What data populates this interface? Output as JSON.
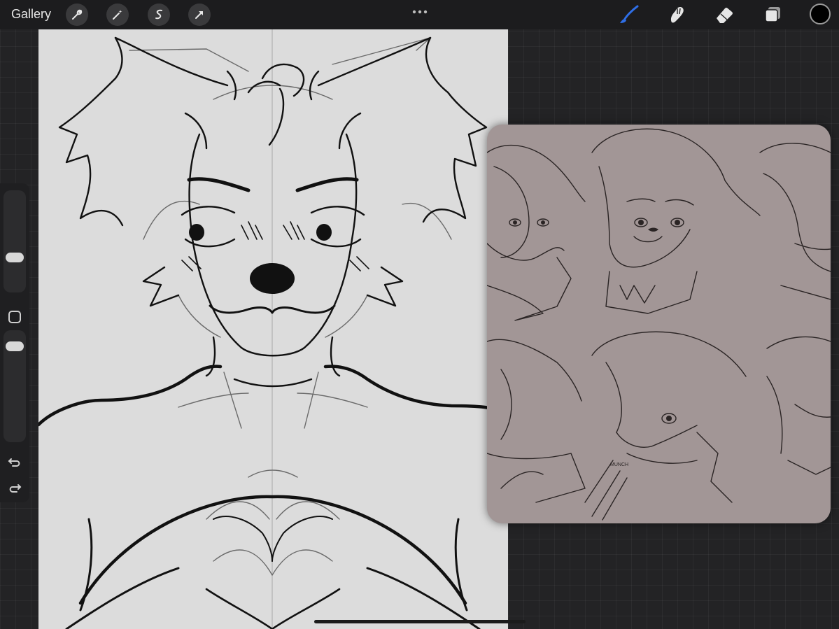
{
  "toolbar": {
    "gallery_label": "Gallery",
    "left_tools": [
      "wrench-icon",
      "magic-wand-icon",
      "selection-icon",
      "transform-arrow-icon"
    ],
    "right_tools": [
      "brush-icon",
      "smudge-icon",
      "eraser-icon",
      "layers-icon"
    ],
    "active_tool": "brush-icon",
    "accent_color": "#2f6fe8",
    "current_color": "#000000"
  },
  "sidebar": {
    "brush_size_icon": "brush-size-slider",
    "opacity_icon": "opacity-slider",
    "modifier_icon": "square-modifier-icon",
    "undo_icon": "undo-icon",
    "redo_icon": "redo-icon"
  },
  "canvas": {
    "background": "#dcdcdc",
    "symmetry_guide": true
  },
  "reference": {
    "background": "#a29696",
    "annotation": "MUNCH"
  }
}
